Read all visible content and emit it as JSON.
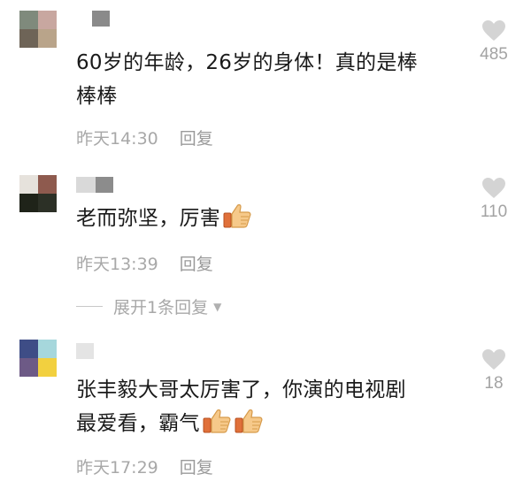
{
  "comments": [
    {
      "text_line1": "60岁的年龄，26岁的身体！真的是棒",
      "text_line2": "棒棒",
      "time": "昨天14:30",
      "reply": "回复",
      "likes": "485",
      "avatar_colors": [
        "#7f8a7c",
        "#c8a7a0",
        "#6e6457",
        "#b9a48a"
      ],
      "name_colors": [
        "#ffffff",
        "#8a8a8a"
      ]
    },
    {
      "text": "老而弥坚，厉害",
      "emoji": "thumbs-up-icon",
      "time": "昨天13:39",
      "reply": "回复",
      "likes": "110",
      "avatar_colors": [
        "#e6e2dc",
        "#8e5a4e",
        "#1f2319",
        "#2c3026"
      ],
      "name_colors": [
        "#d9d9d9",
        "#8c8c8c"
      ]
    },
    {
      "text_line1": "张丰毅大哥太厉害了，你演的电视剧",
      "text_line2": "最爱看，霸气",
      "emoji": "thumbs-up-icon",
      "time": "昨天17:29",
      "reply": "回复",
      "likes": "18",
      "avatar_colors": [
        "#3e4d86",
        "#a6d7dc",
        "#6d5a86",
        "#f2d03f"
      ],
      "name_colors": [
        "#e4e4e4"
      ]
    }
  ],
  "expand_replies": "展开1条回复",
  "accent_color": "#a8a8a8"
}
